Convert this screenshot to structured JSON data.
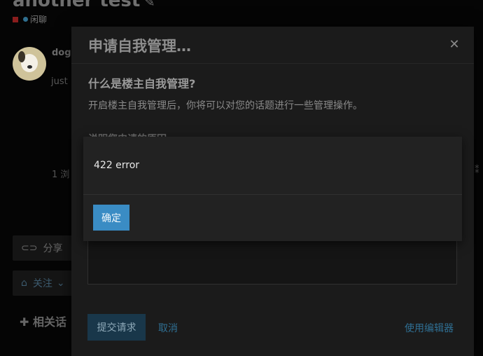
{
  "background": {
    "topic_title": "another test",
    "category": "闲聊",
    "username": "dog",
    "post_text": "just",
    "views": "1 浏",
    "right_glyph": "⁑",
    "share_label": "分享",
    "follow_label": "关注",
    "related_label": "相关话"
  },
  "modal": {
    "title": "申请自我管理…",
    "close_glyph": "✕",
    "heading": "什么是楼主自我管理?",
    "description": "开启楼主自我管理后，你将可以对您的话题进行一些管理操作。",
    "partial_label": "说明您申请的原因",
    "submit_label": "提交请求",
    "cancel_label": "取消",
    "editor_label": "使用编辑器"
  },
  "alert": {
    "message": "422 error",
    "ok_label": "确定"
  }
}
